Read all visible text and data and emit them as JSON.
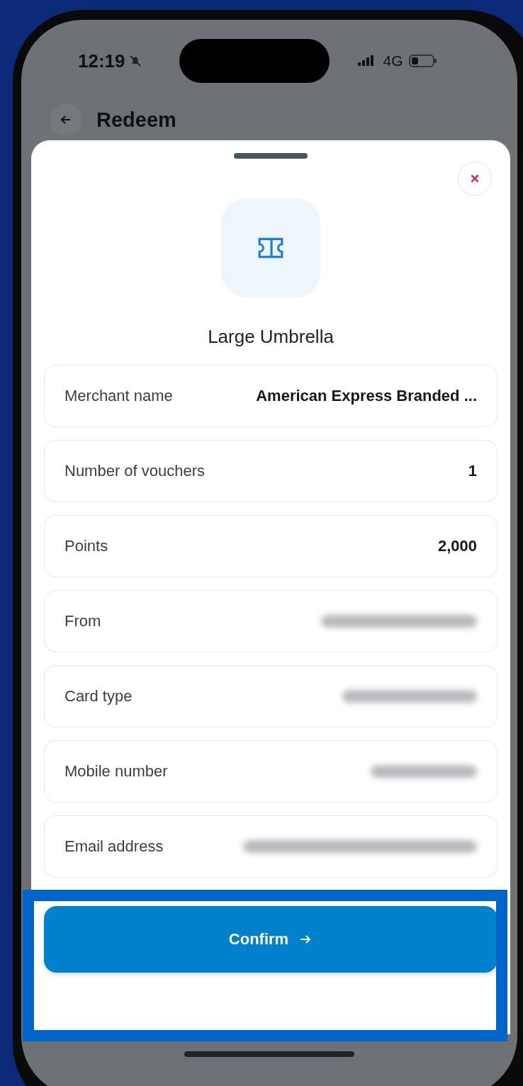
{
  "status_bar": {
    "time": "12:19",
    "network": "4G"
  },
  "header": {
    "title": "Redeem"
  },
  "sheet": {
    "title": "Large Umbrella",
    "rows": [
      {
        "kind": "text",
        "label": "Merchant name",
        "value": "American Express Branded ..."
      },
      {
        "kind": "text",
        "label": "Number of vouchers",
        "value": "1"
      },
      {
        "kind": "text",
        "label": "Points",
        "value": "2,000"
      },
      {
        "kind": "redacted",
        "label": "From"
      },
      {
        "kind": "redacted",
        "label": "Card type"
      },
      {
        "kind": "redacted",
        "label": "Mobile number"
      },
      {
        "kind": "redacted",
        "label": "Email address"
      }
    ],
    "button": {
      "label": "Confirm"
    }
  }
}
